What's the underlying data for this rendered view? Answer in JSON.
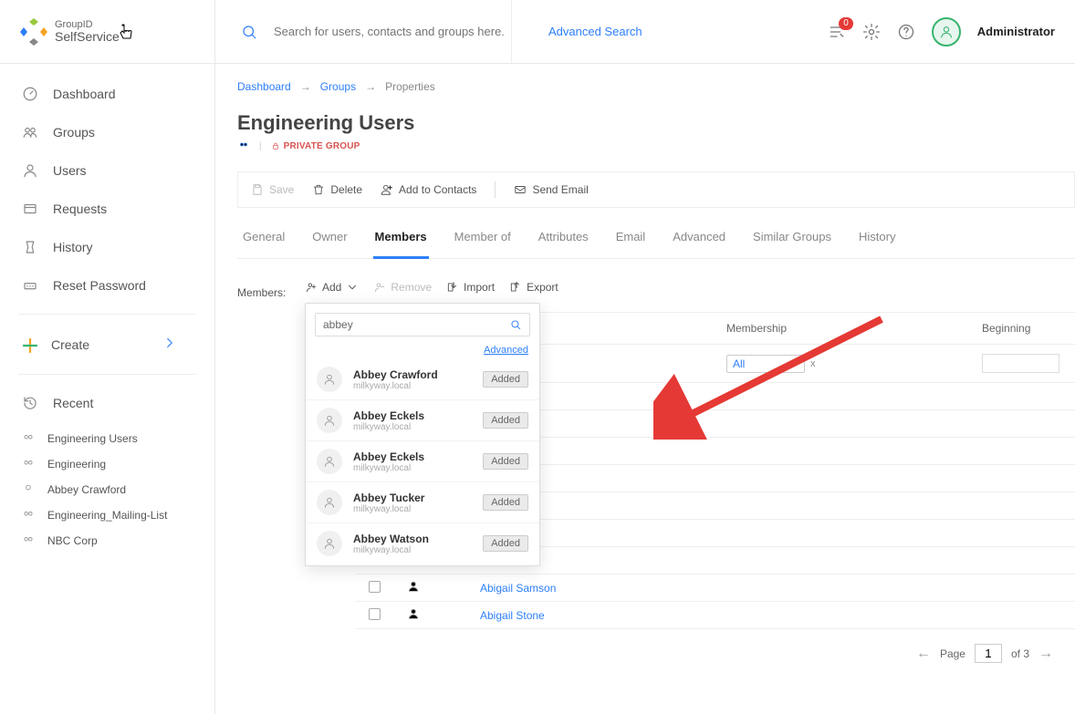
{
  "app": {
    "logoTop": "GroupID",
    "logoSub": "SelfService",
    "searchPlaceholder": "Search for users, contacts and groups here.",
    "advSearch": "Advanced Search",
    "notifCount": "0",
    "username": "Administrator"
  },
  "sidebar": {
    "items": [
      "Dashboard",
      "Groups",
      "Users",
      "Requests",
      "History",
      "Reset Password"
    ],
    "create": "Create",
    "recentLabel": "Recent",
    "recent": [
      "Engineering Users",
      "Engineering",
      "Abbey Crawford",
      "Engineering_Mailing-List",
      "NBC Corp"
    ]
  },
  "breadcrumb": {
    "a": "Dashboard",
    "b": "Groups",
    "c": "Properties"
  },
  "page": {
    "title": "Engineering Users",
    "privLabel": "PRIVATE GROUP"
  },
  "actions": {
    "save": "Save",
    "delete": "Delete",
    "addc": "Add to Contacts",
    "send": "Send Email"
  },
  "tabs": [
    "General",
    "Owner",
    "Members",
    "Member of",
    "Attributes",
    "Email",
    "Advanced",
    "Similar Groups",
    "History"
  ],
  "members": {
    "label": "Members:",
    "add": "Add",
    "remove": "Remove",
    "import": "Import",
    "export": "Export"
  },
  "grid": {
    "cols": {
      "mem": "Membership",
      "beg": "Beginning"
    },
    "filterAll": "All",
    "clear": "x",
    "rows": [
      "Abigail Samson",
      "Abigail Stone"
    ]
  },
  "dropdown": {
    "query": "abbey",
    "advanced": "Advanced",
    "addedLabel": "Added",
    "items": [
      {
        "name": "Abbey Crawford",
        "sub": "milkyway.local"
      },
      {
        "name": "Abbey Eckels",
        "sub": "milkyway.local"
      },
      {
        "name": "Abbey Eckels",
        "sub": "milkyway.local"
      },
      {
        "name": "Abbey Tucker",
        "sub": "milkyway.local"
      },
      {
        "name": "Abbey Watson",
        "sub": "milkyway.local"
      }
    ]
  },
  "pager": {
    "page": "Page",
    "cur": "1",
    "of": "of 3"
  }
}
